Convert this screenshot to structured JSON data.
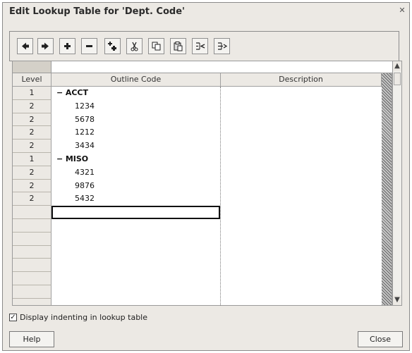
{
  "window": {
    "title": "Edit Lookup Table for 'Dept. Code'"
  },
  "toolbar": {
    "buttons": [
      "move-left-icon",
      "move-right-icon",
      "add-icon",
      "remove-icon",
      "insert-icon",
      "cut-icon",
      "copy-icon",
      "paste-icon",
      "outdent-icon",
      "indent-icon"
    ]
  },
  "grid": {
    "headers": {
      "level": "Level",
      "code": "Outline Code",
      "description": "Description"
    },
    "rows": [
      {
        "level": "1",
        "code": "ACCT",
        "indent": 1
      },
      {
        "level": "2",
        "code": "1234",
        "indent": 2
      },
      {
        "level": "2",
        "code": "5678",
        "indent": 2
      },
      {
        "level": "2",
        "code": "1212",
        "indent": 2
      },
      {
        "level": "2",
        "code": "3434",
        "indent": 2
      },
      {
        "level": "1",
        "code": "MISO",
        "indent": 1
      },
      {
        "level": "2",
        "code": "4321",
        "indent": 2
      },
      {
        "level": "2",
        "code": "9876",
        "indent": 2
      },
      {
        "level": "2",
        "code": "5432",
        "indent": 2
      }
    ],
    "collapse_symbol": "−"
  },
  "options": {
    "display_indenting_label": "Display indenting in lookup table",
    "display_indenting_checked": true
  },
  "buttons": {
    "help": "Help",
    "close": "Close"
  }
}
